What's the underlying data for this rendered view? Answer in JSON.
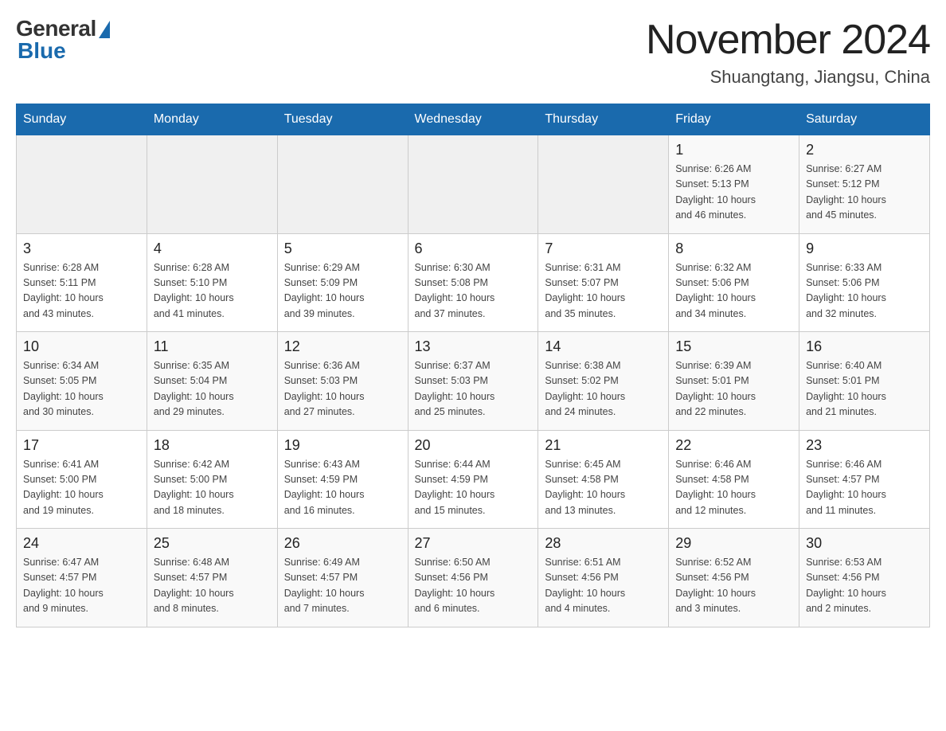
{
  "header": {
    "logo_general": "General",
    "logo_blue": "Blue",
    "month_title": "November 2024",
    "location": "Shuangtang, Jiangsu, China"
  },
  "weekdays": [
    "Sunday",
    "Monday",
    "Tuesday",
    "Wednesday",
    "Thursday",
    "Friday",
    "Saturday"
  ],
  "weeks": [
    [
      {
        "day": "",
        "info": ""
      },
      {
        "day": "",
        "info": ""
      },
      {
        "day": "",
        "info": ""
      },
      {
        "day": "",
        "info": ""
      },
      {
        "day": "",
        "info": ""
      },
      {
        "day": "1",
        "info": "Sunrise: 6:26 AM\nSunset: 5:13 PM\nDaylight: 10 hours\nand 46 minutes."
      },
      {
        "day": "2",
        "info": "Sunrise: 6:27 AM\nSunset: 5:12 PM\nDaylight: 10 hours\nand 45 minutes."
      }
    ],
    [
      {
        "day": "3",
        "info": "Sunrise: 6:28 AM\nSunset: 5:11 PM\nDaylight: 10 hours\nand 43 minutes."
      },
      {
        "day": "4",
        "info": "Sunrise: 6:28 AM\nSunset: 5:10 PM\nDaylight: 10 hours\nand 41 minutes."
      },
      {
        "day": "5",
        "info": "Sunrise: 6:29 AM\nSunset: 5:09 PM\nDaylight: 10 hours\nand 39 minutes."
      },
      {
        "day": "6",
        "info": "Sunrise: 6:30 AM\nSunset: 5:08 PM\nDaylight: 10 hours\nand 37 minutes."
      },
      {
        "day": "7",
        "info": "Sunrise: 6:31 AM\nSunset: 5:07 PM\nDaylight: 10 hours\nand 35 minutes."
      },
      {
        "day": "8",
        "info": "Sunrise: 6:32 AM\nSunset: 5:06 PM\nDaylight: 10 hours\nand 34 minutes."
      },
      {
        "day": "9",
        "info": "Sunrise: 6:33 AM\nSunset: 5:06 PM\nDaylight: 10 hours\nand 32 minutes."
      }
    ],
    [
      {
        "day": "10",
        "info": "Sunrise: 6:34 AM\nSunset: 5:05 PM\nDaylight: 10 hours\nand 30 minutes."
      },
      {
        "day": "11",
        "info": "Sunrise: 6:35 AM\nSunset: 5:04 PM\nDaylight: 10 hours\nand 29 minutes."
      },
      {
        "day": "12",
        "info": "Sunrise: 6:36 AM\nSunset: 5:03 PM\nDaylight: 10 hours\nand 27 minutes."
      },
      {
        "day": "13",
        "info": "Sunrise: 6:37 AM\nSunset: 5:03 PM\nDaylight: 10 hours\nand 25 minutes."
      },
      {
        "day": "14",
        "info": "Sunrise: 6:38 AM\nSunset: 5:02 PM\nDaylight: 10 hours\nand 24 minutes."
      },
      {
        "day": "15",
        "info": "Sunrise: 6:39 AM\nSunset: 5:01 PM\nDaylight: 10 hours\nand 22 minutes."
      },
      {
        "day": "16",
        "info": "Sunrise: 6:40 AM\nSunset: 5:01 PM\nDaylight: 10 hours\nand 21 minutes."
      }
    ],
    [
      {
        "day": "17",
        "info": "Sunrise: 6:41 AM\nSunset: 5:00 PM\nDaylight: 10 hours\nand 19 minutes."
      },
      {
        "day": "18",
        "info": "Sunrise: 6:42 AM\nSunset: 5:00 PM\nDaylight: 10 hours\nand 18 minutes."
      },
      {
        "day": "19",
        "info": "Sunrise: 6:43 AM\nSunset: 4:59 PM\nDaylight: 10 hours\nand 16 minutes."
      },
      {
        "day": "20",
        "info": "Sunrise: 6:44 AM\nSunset: 4:59 PM\nDaylight: 10 hours\nand 15 minutes."
      },
      {
        "day": "21",
        "info": "Sunrise: 6:45 AM\nSunset: 4:58 PM\nDaylight: 10 hours\nand 13 minutes."
      },
      {
        "day": "22",
        "info": "Sunrise: 6:46 AM\nSunset: 4:58 PM\nDaylight: 10 hours\nand 12 minutes."
      },
      {
        "day": "23",
        "info": "Sunrise: 6:46 AM\nSunset: 4:57 PM\nDaylight: 10 hours\nand 11 minutes."
      }
    ],
    [
      {
        "day": "24",
        "info": "Sunrise: 6:47 AM\nSunset: 4:57 PM\nDaylight: 10 hours\nand 9 minutes."
      },
      {
        "day": "25",
        "info": "Sunrise: 6:48 AM\nSunset: 4:57 PM\nDaylight: 10 hours\nand 8 minutes."
      },
      {
        "day": "26",
        "info": "Sunrise: 6:49 AM\nSunset: 4:57 PM\nDaylight: 10 hours\nand 7 minutes."
      },
      {
        "day": "27",
        "info": "Sunrise: 6:50 AM\nSunset: 4:56 PM\nDaylight: 10 hours\nand 6 minutes."
      },
      {
        "day": "28",
        "info": "Sunrise: 6:51 AM\nSunset: 4:56 PM\nDaylight: 10 hours\nand 4 minutes."
      },
      {
        "day": "29",
        "info": "Sunrise: 6:52 AM\nSunset: 4:56 PM\nDaylight: 10 hours\nand 3 minutes."
      },
      {
        "day": "30",
        "info": "Sunrise: 6:53 AM\nSunset: 4:56 PM\nDaylight: 10 hours\nand 2 minutes."
      }
    ]
  ]
}
